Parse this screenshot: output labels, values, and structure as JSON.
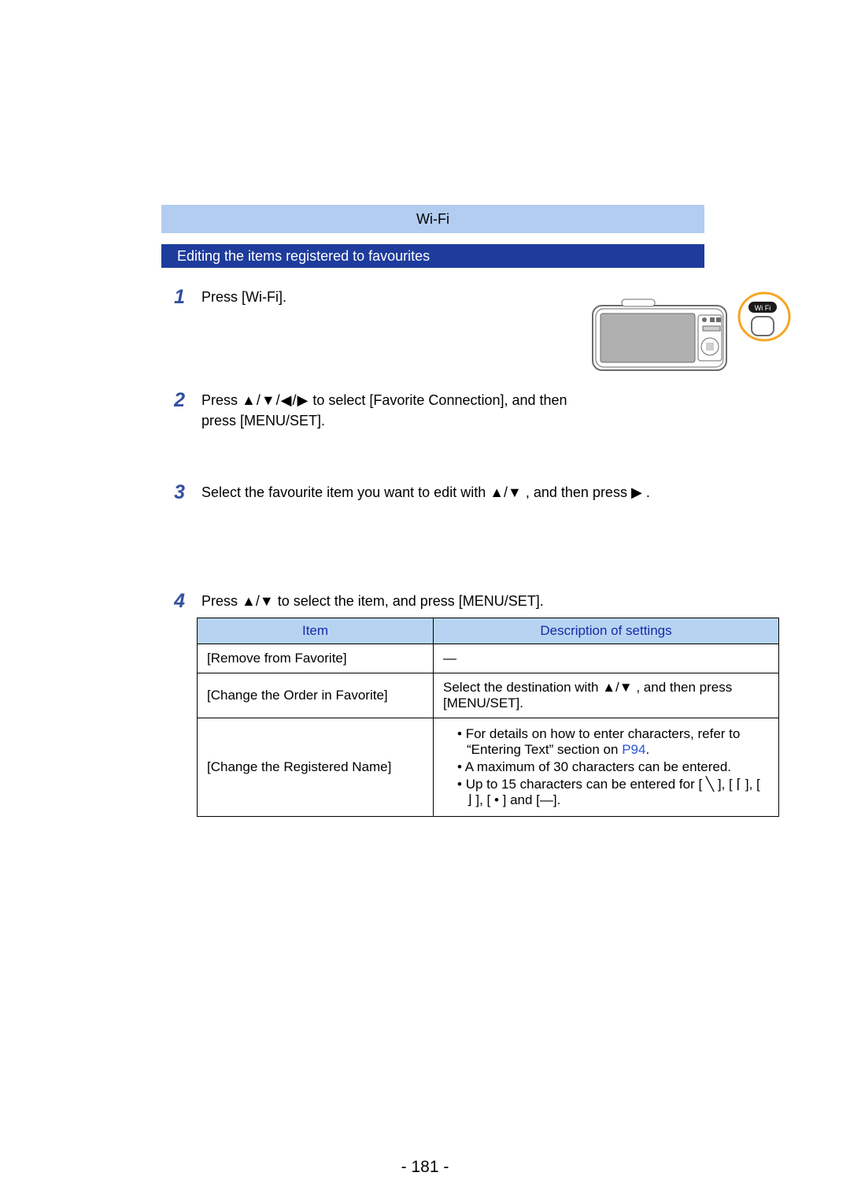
{
  "header": {
    "section": "Wi-Fi"
  },
  "subheader": {
    "title": "Editing the items registered to favourites"
  },
  "steps": {
    "s1": {
      "num": "1",
      "text": "Press [Wi-Fi]."
    },
    "s2": {
      "num": "2",
      "pre": "Press ",
      "arrows": "▲/▼/◀/▶",
      "mid": " to select [Favorite Connection], and then press [MENU/SET]."
    },
    "s3": {
      "num": "3",
      "pre": "Select the favourite item you want to edit with ",
      "arrows": "▲/▼",
      "mid": ", and then press ",
      "right": "▶",
      "end": "."
    },
    "s4": {
      "num": "4",
      "pre": "Press ",
      "arrows": "▲/▼",
      "mid": " to select the item, and press [MENU/SET]."
    }
  },
  "table": {
    "head": {
      "c1": "Item",
      "c2": "Description of settings"
    },
    "rows": {
      "r1": {
        "item": "[Remove from Favorite]",
        "desc": "—"
      },
      "r2": {
        "item": "[Change the Order in Favorite]",
        "desc_pre": "Select the destination with ",
        "desc_arrows": "▲/▼",
        "desc_post": ", and then press [MENU/SET]."
      },
      "r3": {
        "item": "[Change the Registered Name]",
        "b1a": "For details on how to enter characters, refer to “Entering Text” section on ",
        "b1_link": "P94",
        "b1b": ".",
        "b2": "A maximum of 30 characters can be entered.",
        "b3": "Up to 15 characters can be entered for [ ╲ ], [ ⌈ ], [ ⌋ ], [ • ] and [—]."
      }
    }
  },
  "page_number": "- 181 -"
}
